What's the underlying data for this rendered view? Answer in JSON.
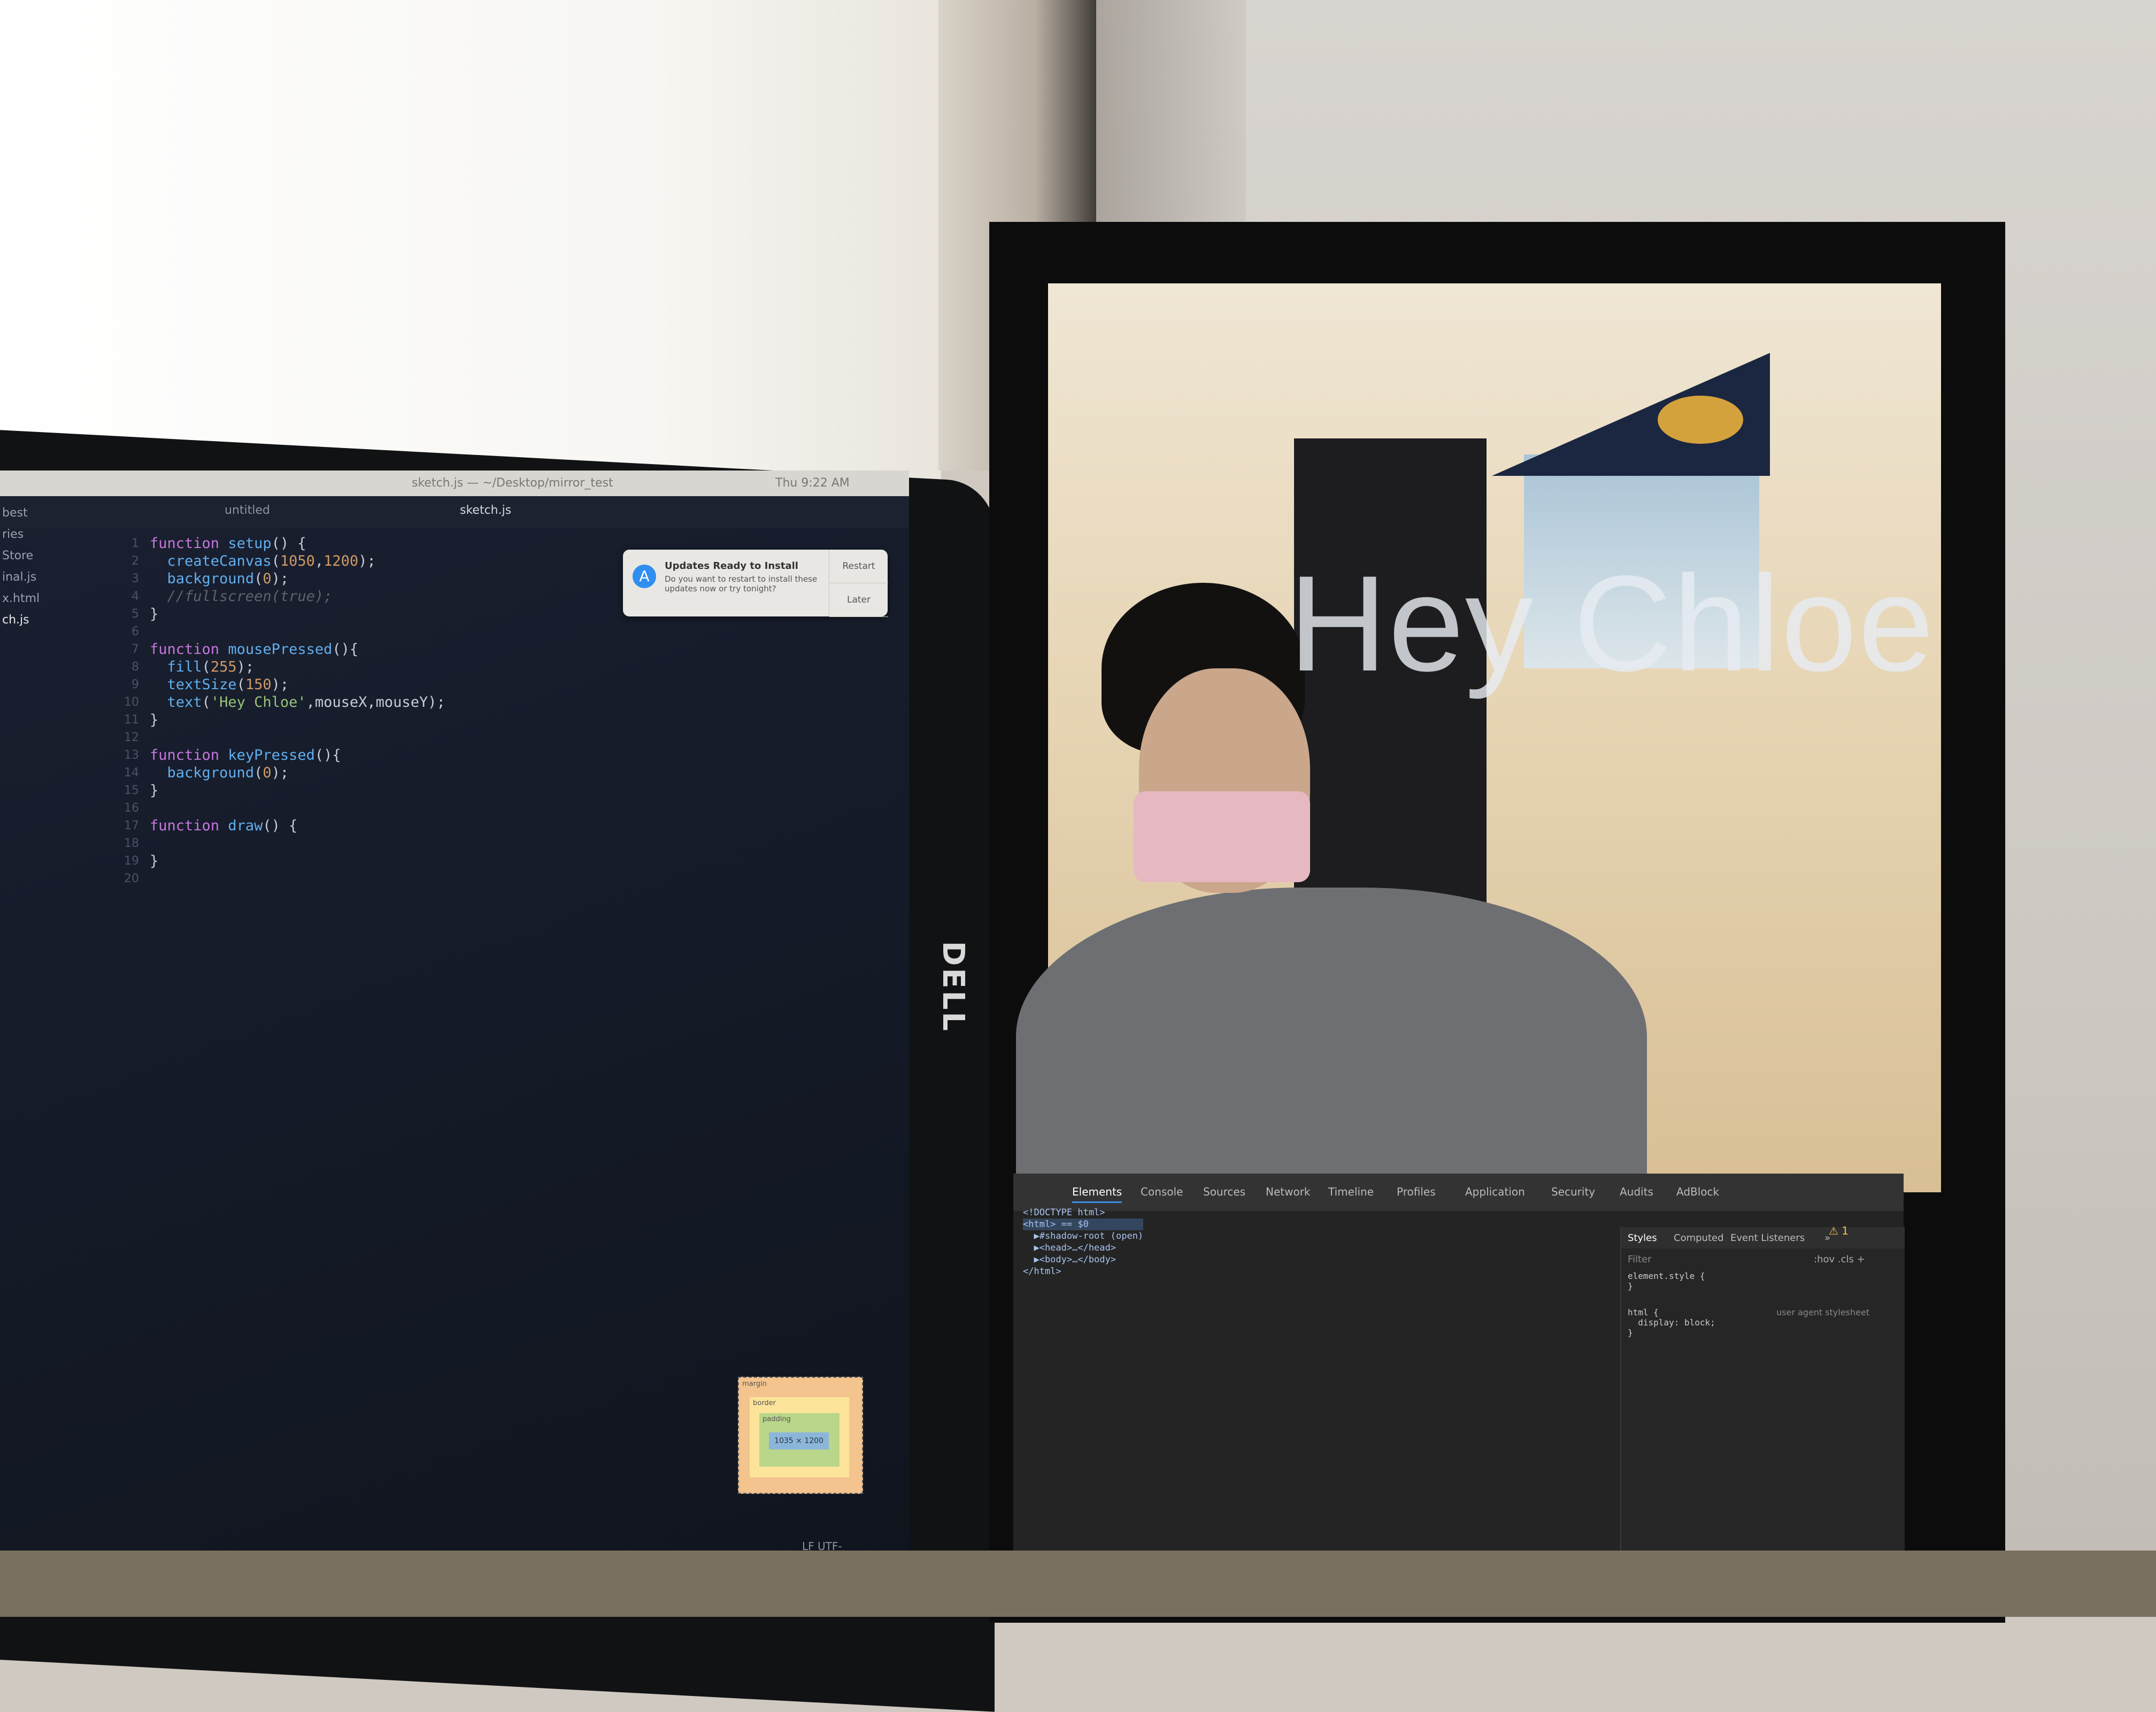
{
  "editor": {
    "menubar_title": "sketch.js — ~/Desktop/mirror_test",
    "menubar_clock": "Thu 9:22 AM",
    "tabs": [
      "untitled",
      "sketch.js"
    ],
    "sidebar_items": [
      "best",
      "ries",
      "Store",
      "inal.js",
      "x.html",
      "ch.js"
    ],
    "line_numbers": [
      "1",
      "2",
      "3",
      "4",
      "5",
      "6",
      "7",
      "8",
      "9",
      "10",
      "11",
      "12",
      "13",
      "14",
      "15",
      "16",
      "17",
      "18",
      "19",
      "20"
    ],
    "code_lines": [
      "function setup() {",
      "  createCanvas(1050,1200);",
      "  background(0);",
      "  //fullscreen(true);",
      "}",
      "",
      "function mousePressed(){",
      "  fill(255);",
      "  textSize(150);",
      "  text('Hey Chloe',mouseX,mouseY);",
      "}",
      "",
      "function keyPressed(){",
      "  background(0);",
      "}",
      "",
      "function draw() {",
      "",
      "}",
      ""
    ],
    "statusbar": "LF  UTF-"
  },
  "notification": {
    "title": "Updates Ready to Install",
    "body": "Do you want to restart to install these updates now or try tonight?",
    "restart_label": "Restart",
    "later_label": "Later"
  },
  "mirror": {
    "overlay_text": "Hey Chloe",
    "brand": "DELL"
  },
  "devtools": {
    "tabs": [
      "Elements",
      "Console",
      "Sources",
      "Network",
      "Timeline",
      "Profiles",
      "Application",
      "Security",
      "Audits",
      "AdBlock"
    ],
    "active_tab": "Elements",
    "warning_count": "1",
    "dom_lines": [
      "<!DOCTYPE html>",
      "<html> == $0",
      "  ▶#shadow-root (open)",
      "  ▶<head>…</head>",
      "  ▶<body>…</body>",
      "</html>"
    ],
    "styles_tabs": [
      "Styles",
      "Computed",
      "Event Listeners",
      "»"
    ],
    "filter_placeholder": "Filter",
    "hov_cls": ":hov  .cls  +",
    "rule_element_style": "element.style {\n}",
    "rule_html": "html {\n  display: block;\n}",
    "user_agent_label": "user agent stylesheet",
    "box_model": {
      "margin_label": "margin",
      "border_label": "border",
      "padding_label": "padding",
      "content_size": "1035 × 1200"
    }
  }
}
